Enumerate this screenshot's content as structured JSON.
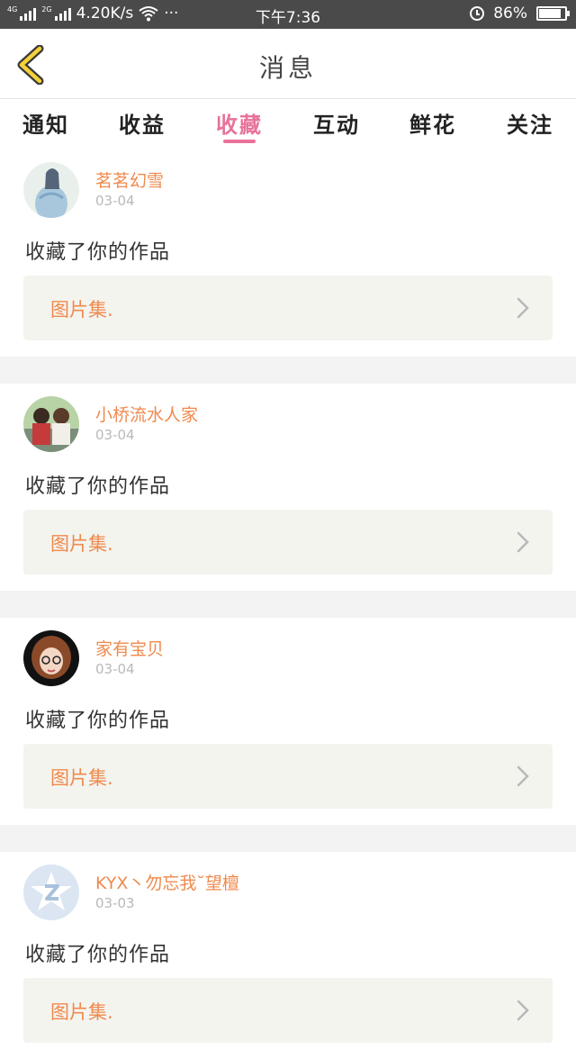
{
  "status_bar": {
    "net_4g": "4G",
    "net_2g": "2G",
    "speed": "4.20K/s",
    "more": "···",
    "time": "下午7:36",
    "battery_percent": "86%",
    "battery_level": 0.86
  },
  "header": {
    "title": "消息"
  },
  "tabs": [
    {
      "label": "通知"
    },
    {
      "label": "收益"
    },
    {
      "label": "收藏"
    },
    {
      "label": "互动"
    },
    {
      "label": "鲜花"
    },
    {
      "label": "关注"
    }
  ],
  "active_tab": "收藏",
  "feed": [
    {
      "username": "茗茗幻雪",
      "date": "03-04",
      "action": "收藏了你的作品",
      "work_title": "图片集."
    },
    {
      "username": "小桥流水人家",
      "date": "03-04",
      "action": "收藏了你的作品",
      "work_title": "图片集."
    },
    {
      "username": "家有宝贝",
      "date": "03-04",
      "action": "收藏了你的作品",
      "work_title": "图片集."
    },
    {
      "username": "KYX丶勿忘我˘望檀",
      "date": "03-03",
      "action": "收藏了你的作品",
      "work_title": "图片集."
    }
  ],
  "colors": {
    "accent_pink": "#e8729a",
    "username_orange": "#ef8a4e",
    "status_bar": "#4a4a4a",
    "back_arrow_yellow": "#f4d23a"
  },
  "icons": {
    "back": "back-arrow-icon",
    "chevron": "chevron-right-icon",
    "wifi": "wifi-icon",
    "alarm": "alarm-clock-icon",
    "battery": "battery-icon"
  }
}
